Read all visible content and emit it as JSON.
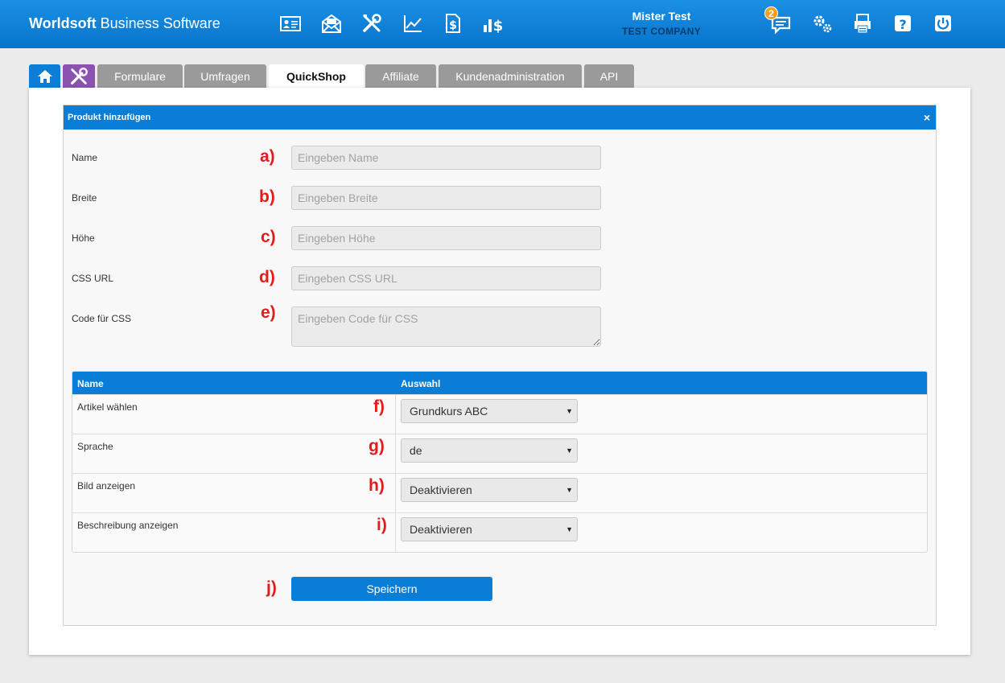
{
  "header": {
    "brand_bold": "Worldsoft",
    "brand_rest": " Business Software",
    "user_name": "Mister Test",
    "company": "TEST COMPANY",
    "notification_count": "2",
    "nav_icons": [
      "contact-card-icon",
      "mail-envelope-icon",
      "tools-icon",
      "chart-line-icon",
      "invoice-dollar-icon",
      "bar-chart-dollar-icon"
    ],
    "right_icons": [
      "messages-icon",
      "settings-gears-icon",
      "printer-icon",
      "help-icon",
      "power-icon"
    ]
  },
  "tabs": [
    {
      "label": "Formulare"
    },
    {
      "label": "Umfragen"
    },
    {
      "label": "QuickShop",
      "active": true
    },
    {
      "label": "Affiliate"
    },
    {
      "label": "Kundenadministration"
    },
    {
      "label": "API"
    }
  ],
  "dialog": {
    "title": "Produkt hinzufügen",
    "close": "×",
    "fields": [
      {
        "label": "Name",
        "marker": "a)",
        "placeholder": "Eingeben Name"
      },
      {
        "label": "Breite",
        "marker": "b)",
        "placeholder": "Eingeben Breite"
      },
      {
        "label": "Höhe",
        "marker": "c)",
        "placeholder": "Eingeben Höhe"
      },
      {
        "label": "CSS URL",
        "marker": "d)",
        "placeholder": "Eingeben CSS URL"
      },
      {
        "label": "Code für CSS",
        "marker": "e)",
        "placeholder": "Eingeben Code für CSS"
      }
    ],
    "table": {
      "col_name": "Name",
      "col_select": "Auswahl",
      "rows": [
        {
          "label": "Artikel wählen",
          "marker": "f)",
          "value": "Grundkurs ABC"
        },
        {
          "label": "Sprache",
          "marker": "g)",
          "value": "de"
        },
        {
          "label": "Bild anzeigen",
          "marker": "h)",
          "value": "Deaktivieren"
        },
        {
          "label": "Beschreibung anzeigen",
          "marker": "i)",
          "value": "Deaktivieren"
        }
      ]
    },
    "save_marker": "j)",
    "save_label": "Speichern"
  },
  "colors": {
    "header_blue": "#0a7ed6",
    "marker_red": "#e21b1b",
    "tools_tab_purple": "#8b52b0",
    "badge_orange": "#f5a01a"
  }
}
